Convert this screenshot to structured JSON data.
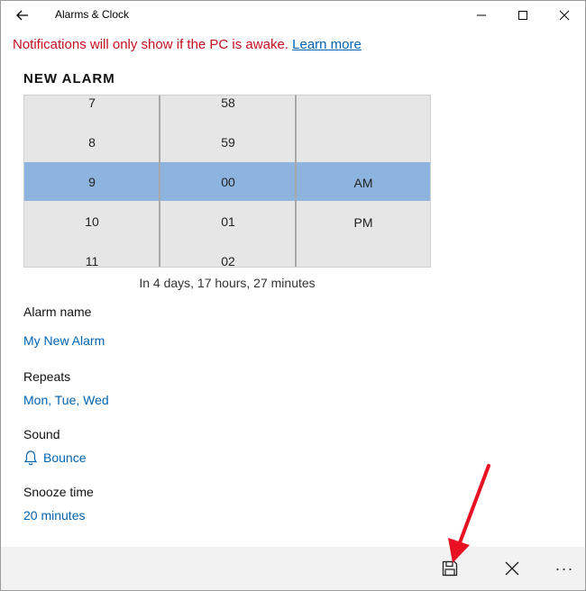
{
  "window": {
    "title": "Alarms & Clock"
  },
  "notice": {
    "text": "Notifications will only show if the PC is awake.",
    "link": "Learn more"
  },
  "editor": {
    "heading": "NEW ALARM",
    "picker": {
      "hours": [
        "7",
        "8",
        "9",
        "10",
        "11"
      ],
      "minutes": [
        "58",
        "59",
        "00",
        "01",
        "02"
      ],
      "periods": [
        "AM",
        "PM"
      ],
      "selected": {
        "hour": "9",
        "minute": "00",
        "period": "AM"
      }
    },
    "countdown": "In 4 days, 17 hours, 27 minutes",
    "fields": {
      "alarm_name": {
        "label": "Alarm name",
        "value": "My New Alarm"
      },
      "repeats": {
        "label": "Repeats",
        "value": "Mon, Tue, Wed"
      },
      "sound": {
        "label": "Sound",
        "value": "Bounce",
        "icon": "bell-icon"
      },
      "snooze": {
        "label": "Snooze time",
        "value": "20 minutes"
      }
    }
  },
  "commandbar": {
    "icons": [
      "save-icon",
      "close-icon",
      "more-icon"
    ],
    "more_glyph": "···"
  },
  "colors": {
    "accent": "#0063b1",
    "warning": "#c50f1f",
    "selection": "#8cb4de",
    "annotation_arrow": "#e81123"
  }
}
